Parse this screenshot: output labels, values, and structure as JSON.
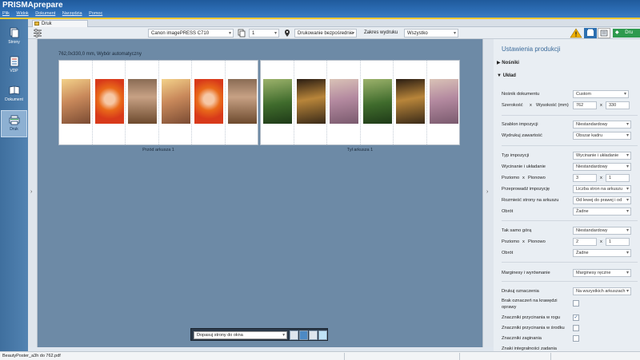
{
  "app": {
    "title": "PRISMAprepare"
  },
  "menu": [
    "Plik",
    "Widok",
    "Dokument",
    "Narzędzia",
    "Pomoc"
  ],
  "nav": [
    {
      "label": "Strony",
      "icon": "pages-icon"
    },
    {
      "label": "VDP",
      "icon": "vdp-icon"
    },
    {
      "label": "Dokument",
      "icon": "document-icon"
    },
    {
      "label": "Druk",
      "icon": "print-icon",
      "active": true
    }
  ],
  "tab": {
    "label": "Druk"
  },
  "toolbar": {
    "printer": "Canon imagePRESS C710",
    "copies": "1",
    "print_mode": "Drukowanie bezpośrednie",
    "range_label": "Zakres wydruku",
    "range_value": "Wszystko",
    "action_label": "Dru"
  },
  "preview": {
    "sheet_info": "762,0x330,0 mm, Wybór automatyczny",
    "front_caption": "Przód arkusza 1",
    "back_caption": "Tył arkusza 1",
    "fit_option": "Dopasuj strony do okna"
  },
  "panel": {
    "title": "Ustawienia produkcji",
    "sections": {
      "media": "Nośniki",
      "layout": "Układ"
    },
    "fields": {
      "media_label": "Nośnik dokumentu",
      "media_value": "Custom",
      "size_label": "Szerokość",
      "size_x": "x",
      "size_height_label": "Wysokość (mm)",
      "width": "762",
      "height": "330",
      "template_label": "Szablon impozycji",
      "template_value": "Niestandardowy",
      "content_label": "Wydrukuj zawartość",
      "content_value": "Obszar kadru",
      "type_label": "Typ impozycji",
      "type_value": "Wycinanie i układanie",
      "cut_label": "Wycinanie i układanie",
      "cut_value": "Niestandardowy",
      "h_label": "Poziomo",
      "x_sep": "x",
      "v_label": "Pionowo",
      "h_value": "3",
      "v_value": "1",
      "perform_label": "Przeprowadź impozycję",
      "perform_value": "Liczba stron na arkuszu",
      "arrange_label": "Rozmieść strony na arkuszu",
      "arrange_value": "Od lewej do prawej i od",
      "rotation_label": "Obrót",
      "rotation_value": "Żadne",
      "same_label": "Tak samo górą",
      "same_value": "Niestandardowy",
      "h2_value": "2",
      "v2_value": "1",
      "rotation2_value": "Żadne",
      "margins_label": "Marginesy i wyrównanie",
      "margins_value": "Marginesy ręczne",
      "marks_label": "Drukuj oznaczenia",
      "marks_value": "Na wszystkich arkuszach",
      "no_edge_label_1": "Brak oznaczeń na krawędzi",
      "no_edge_label_2": "oprawy",
      "corner_label": "Znaczniki przycinania w rogu",
      "center_label": "Znaczniki przycinania w środku",
      "fold_label": "Znaczniki zaginania",
      "integrity_label": "Znaki integralności zadania"
    }
  },
  "status": {
    "file": "BeautyPoster_a3h do 762.pdf"
  }
}
